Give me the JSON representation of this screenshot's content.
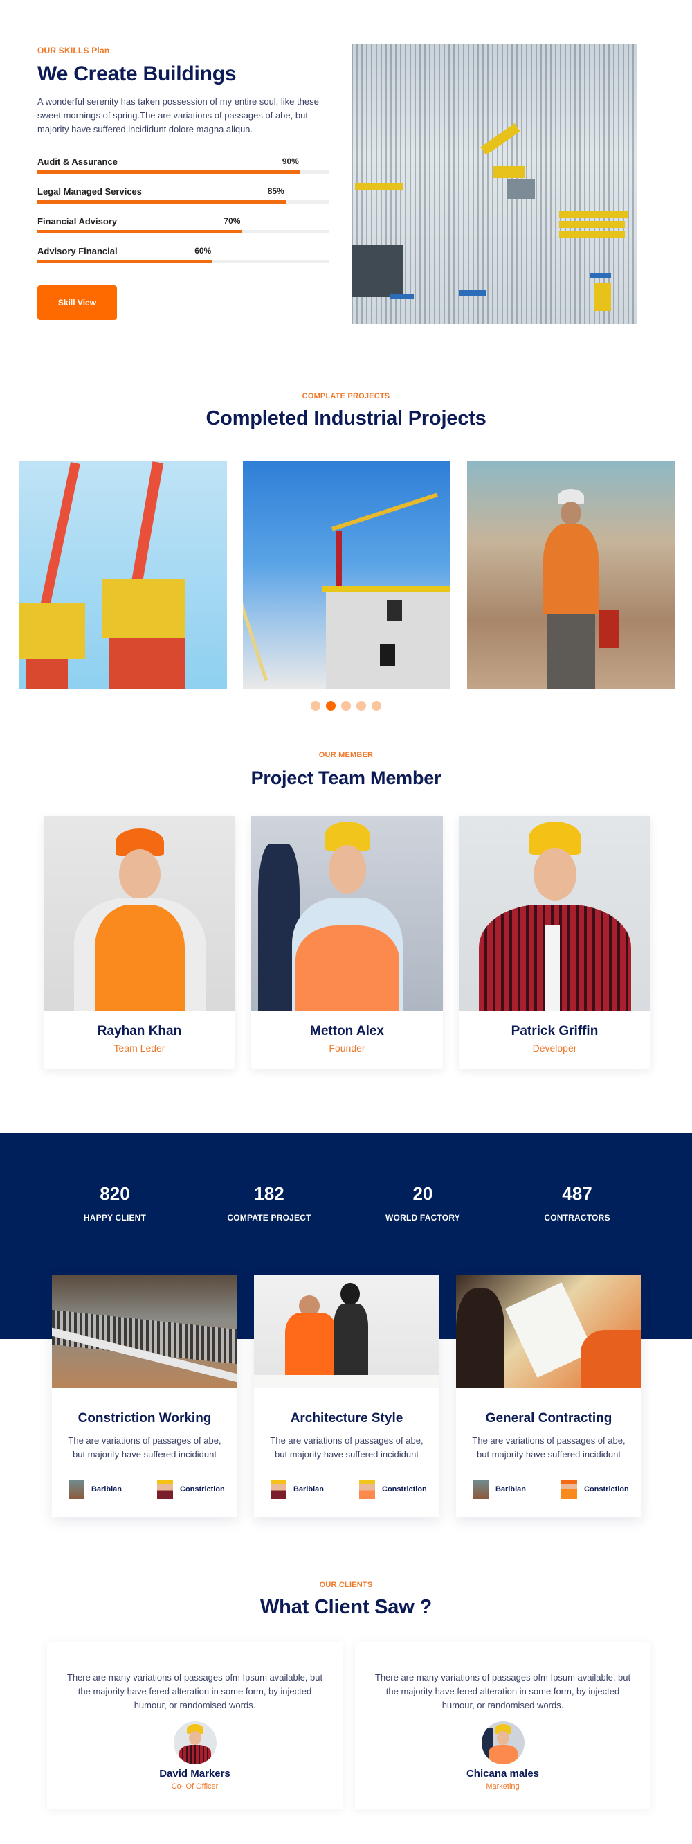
{
  "colors": {
    "accent": "#ff6a00",
    "eyebrow": "#f0782a",
    "navy": "#0c1b55",
    "band": "#00205b",
    "track": "#eceef0"
  },
  "skills": {
    "eyebrow": "OUR SKILLS Plan",
    "title": "We Create Buildings",
    "description": "A wonderful serenity has taken possession of my entire soul, like these sweet mornings of spring.The are variations of passages of abe, but majority have suffered incididunt dolore magna aliqua.",
    "items": [
      {
        "label": "Audit & Assurance",
        "percent": 90,
        "percent_label": "90%"
      },
      {
        "label": "Legal Managed Services",
        "percent": 85,
        "percent_label": "85%"
      },
      {
        "label": "Financial Advisory",
        "percent": 70,
        "percent_label": "70%"
      },
      {
        "label": "Advisory Financial",
        "percent": 60,
        "percent_label": "60%"
      }
    ],
    "button_label": "Skill View",
    "image_alt": "construction-site-aerial"
  },
  "projects": {
    "eyebrow": "COMPLATE PROJECTS",
    "title": "Completed Industrial Projects",
    "images": [
      "port-cranes",
      "building-under-construction",
      "site-worker"
    ],
    "carousel": {
      "total_dots": 5,
      "active_index": 1
    }
  },
  "team": {
    "eyebrow": "OUR MEMBER",
    "title": "Project Team Member",
    "members": [
      {
        "name": "Rayhan Khan",
        "role": "Team Leder"
      },
      {
        "name": "Metton Alex",
        "role": "Founder"
      },
      {
        "name": "Patrick Griffin",
        "role": "Developer"
      }
    ]
  },
  "counters": [
    {
      "value": "820",
      "label": "HAPPY CLIENT"
    },
    {
      "value": "182",
      "label": "COMPATE PROJECT"
    },
    {
      "value": "20",
      "label": "WORLD FACTORY"
    },
    {
      "value": "487",
      "label": "CONTRACTORS"
    }
  ],
  "services": [
    {
      "title": "Constriction Working",
      "description": "The are variations of passages of abe, but majority have suffered incididunt",
      "meta": [
        "Bariblan",
        "Constriction"
      ]
    },
    {
      "title": "Architecture Style",
      "description": "The are variations of passages of abe, but majority have suffered incididunt",
      "meta": [
        "Bariblan",
        "Constriction"
      ]
    },
    {
      "title": "General Contracting",
      "description": "The are variations of passages of abe, but majority have suffered incididunt",
      "meta": [
        "Bariblan",
        "Constriction"
      ]
    }
  ],
  "clients": {
    "eyebrow": "OUR CLIENTS",
    "title": "What Client Saw ?",
    "testimonials": [
      {
        "text": "There are many variations of passages ofm Ipsum available, but the majority have fered alteration in some form, by injected humour, or randomised words.",
        "name": "David Markers",
        "role": "Co- Of Officer"
      },
      {
        "text": "There are many variations of passages ofm Ipsum available, but the majority have fered alteration in some form, by injected humour, or randomised words.",
        "name": "Chicana males",
        "role": "Marketing"
      }
    ]
  }
}
